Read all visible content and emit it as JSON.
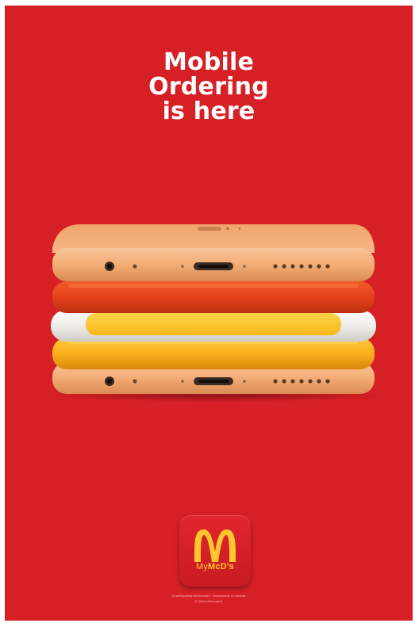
{
  "poster": {
    "background_color": "#d71f26",
    "headline": [
      "Mobile",
      "Ordering",
      "is here"
    ]
  },
  "phones": {
    "count": 5,
    "colors_top_to_bottom": [
      "#f6b47c",
      "#ea4a1e",
      "#f3f1ec",
      "#fbb01c",
      "#f6b47c"
    ]
  },
  "app_icon": {
    "icon": "golden-arches-icon",
    "name_prefix": "My",
    "name_brand": "McD's",
    "brand_color": "#ffc72c"
  },
  "fine_print": {
    "line1": "#CanEquitably McDonald's · Restaurants in Canada",
    "line2": "© 2016 McDonald's"
  }
}
